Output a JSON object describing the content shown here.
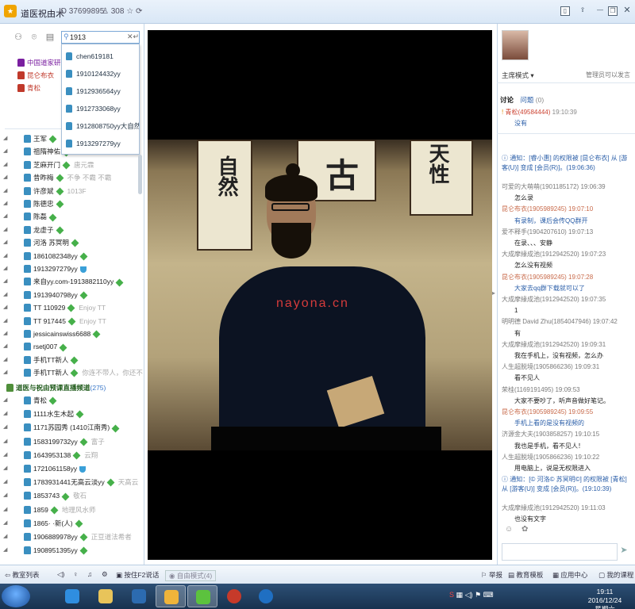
{
  "titlebar": {
    "logo_text": "★",
    "channel_name": "道医祝由术",
    "channel_id": "ID 37699895",
    "online_count": "308"
  },
  "left": {
    "search_value": "1913",
    "dropdown": [
      "chen619181",
      "1910124432yy",
      "1912936564yy",
      "1912733068yy",
      "1912808750yy大自然",
      "1913297279yy"
    ],
    "top_tree": [
      {
        "name": "中国道家研",
        "color": "#7a1fa0"
      },
      {
        "name": "昆仑布衣",
        "color": "#c0392b"
      },
      {
        "name": "青松",
        "color": "#c0392b"
      }
    ],
    "members": [
      {
        "name": "王军",
        "sig": ""
      },
      {
        "name": "祖隋神佑",
        "sig": ""
      },
      {
        "name": "芝麻开门",
        "sig": "唐元霖"
      },
      {
        "name": "昔昨梅",
        "sig": "不争  不霸  不霸"
      },
      {
        "name": "许彦斌",
        "sig": "1013F"
      },
      {
        "name": "陈德忠",
        "sig": ""
      },
      {
        "name": "陈磊",
        "sig": ""
      },
      {
        "name": "龙虚子",
        "sig": ""
      },
      {
        "name": "河洛    苏冥明",
        "sig": ""
      },
      {
        "name": "1861082348yy",
        "sig": ""
      },
      {
        "name": "1913297279yy",
        "sig": ""
      },
      {
        "name": "来自yy.com-1913882110yy",
        "sig": ""
      },
      {
        "name": "1913940798yy",
        "sig": ""
      },
      {
        "name": "TT 110929",
        "sig": "Enjoy TT"
      },
      {
        "name": "TT 917445",
        "sig": "Enjoy TT"
      },
      {
        "name": "jessicainswiss6688",
        "sig": ""
      },
      {
        "name": "rsetj007",
        "sig": ""
      },
      {
        "name": "手机TT新人",
        "sig": ""
      },
      {
        "name": "手机TT新人",
        "sig": "你连不带人，你还不"
      }
    ],
    "subchannel": {
      "name": "道医与祝由预课直播频道",
      "count": "(275)"
    },
    "sub_members": [
      {
        "name": "青松",
        "sig": ""
      },
      {
        "name": "1111水生木起",
        "sig": ""
      },
      {
        "name": "1171苏园秀 (1410江南秀)",
        "sig": ""
      },
      {
        "name": "1583199732yy",
        "sig": "富子"
      },
      {
        "name": "1643953138",
        "sig": "云翔"
      },
      {
        "name": "1721061158yy",
        "sig": ""
      },
      {
        "name": "1783931441无高云淡yy",
        "sig": "天高云"
      },
      {
        "name": "1853743",
        "sig": "敬石"
      },
      {
        "name": "1859",
        "sig": "地理风水师"
      },
      {
        "name": "1865·    ·新(人)",
        "sig": ""
      },
      {
        "name": "1906889978yy",
        "sig": "正豆道法希者"
      },
      {
        "name": "1908951395yy",
        "sig": ""
      }
    ]
  },
  "video": {
    "watermark": "nayona.cn",
    "scroll_left_text": "自然",
    "scroll_mid_text": "古",
    "scroll_right_text": "天性"
  },
  "right": {
    "mode_label": "主席模式",
    "mode_hint": "管理员可以发言",
    "tab_discuss": "讨论",
    "tab_question": "问题",
    "question_count": "(0)",
    "pinned": {
      "sender": "青松(49584444)",
      "time": "19:10:39",
      "text": "没有"
    },
    "messages": [
      {
        "type": "notice",
        "text": "通知：[睿小惠] 的权限被 [昆仑布衣] 从 [游客(U)] 变成 [会员(R)]。(19:06:36)"
      },
      {
        "type": "sender",
        "text": "可爱的大萌萌(1901185172) 19:06:39"
      },
      {
        "type": "text",
        "text": "怎么录"
      },
      {
        "type": "sender red",
        "text": "昆仑布衣(1905989245) 19:07:10"
      },
      {
        "type": "text notice",
        "text": "有录制，课后会传QQ群开"
      },
      {
        "type": "sender",
        "text": "爱不释手(1904207610) 19:07:13"
      },
      {
        "type": "text",
        "text": "在录、、、安静"
      },
      {
        "type": "sender",
        "text": "大成摩緣成池(1912942520) 19:07:23"
      },
      {
        "type": "text",
        "text": "怎么没有视频"
      },
      {
        "type": "sender red",
        "text": "昆仑布衣(1905989245) 19:07:28"
      },
      {
        "type": "text notice",
        "text": "大家去qq群下载就可以了"
      },
      {
        "type": "sender",
        "text": "大成摩緣成池(1912942520) 19:07:35"
      },
      {
        "type": "text",
        "text": "1"
      },
      {
        "type": "sender",
        "text": "明明德    David Zhu(1854047946) 19:07:42"
      },
      {
        "type": "text",
        "text": "有"
      },
      {
        "type": "sender",
        "text": "大成摩緣成池(1912942520) 19:09:31"
      },
      {
        "type": "text",
        "text": "我在手机上，没有视频，怎么办"
      },
      {
        "type": "sender",
        "text": "人生超脱境(1905866236) 19:09:31"
      },
      {
        "type": "text",
        "text": "看不见人"
      },
      {
        "type": "sender",
        "text": "荣桂(1169191495) 19:09:53"
      },
      {
        "type": "text",
        "text": "大家不要吵了，听声音做好笔记。"
      },
      {
        "type": "sender red",
        "text": "昆仑布衣(1905989245) 19:09:55"
      },
      {
        "type": "text notice",
        "text": "手机上看的是没有视频的"
      },
      {
        "type": "sender",
        "text": "济源金大夫(1903858257) 19:10:15"
      },
      {
        "type": "text",
        "text": "我也是手机，看不见人！"
      },
      {
        "type": "sender",
        "text": "人生超脱境(1905866236) 19:10:22"
      },
      {
        "type": "text",
        "text": "用电脑上，说是无权限进入"
      },
      {
        "type": "notice",
        "text": "通知：[© 河洛© 苏冥明©] 的权限被 [青松] 从 [游客(U)] 变成 [会员(R)]。(19:10:39)"
      },
      {
        "type": "sender",
        "text": "大成摩緣成池(1912942520) 19:11:03"
      },
      {
        "type": "text",
        "text": "也没有文字"
      }
    ]
  },
  "bottombar": {
    "items": [
      "教室列表",
      "按住F2说话",
      "自由模式(4)",
      "举报",
      "教育模板",
      "应用中心",
      "我的课程"
    ]
  },
  "taskbar": {
    "time": "19:11",
    "date": "2016/12/24 星期六"
  }
}
